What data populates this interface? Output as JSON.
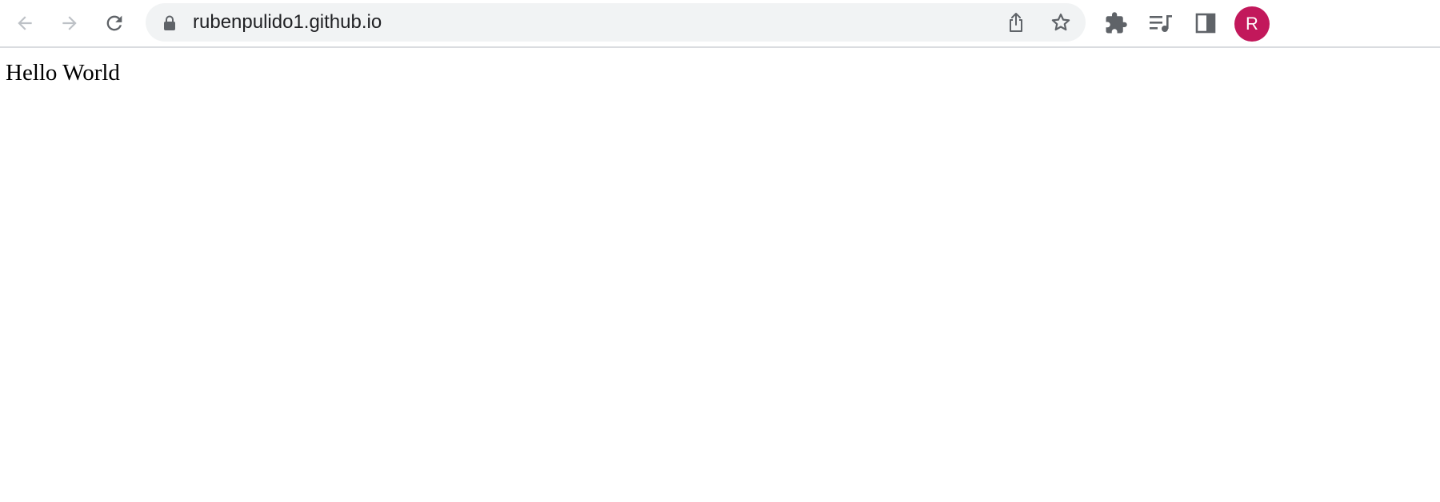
{
  "browser": {
    "address_bar": {
      "url": "rubenpulido1.github.io"
    },
    "icons": {
      "back": "back-arrow-icon",
      "forward": "forward-arrow-icon",
      "reload": "reload-icon",
      "lock": "lock-icon",
      "share": "share-icon",
      "bookmark": "star-icon",
      "extensions": "puzzle-piece-icon",
      "media": "media-queue-icon",
      "side_panel": "side-panel-icon"
    },
    "profile": {
      "initial": "R",
      "color": "#c2185b"
    },
    "colors": {
      "omnibox_bg": "#f1f3f4",
      "icon": "#5f6368",
      "icon_disabled": "#bdc1c6"
    }
  },
  "page": {
    "body_text": "Hello World"
  }
}
